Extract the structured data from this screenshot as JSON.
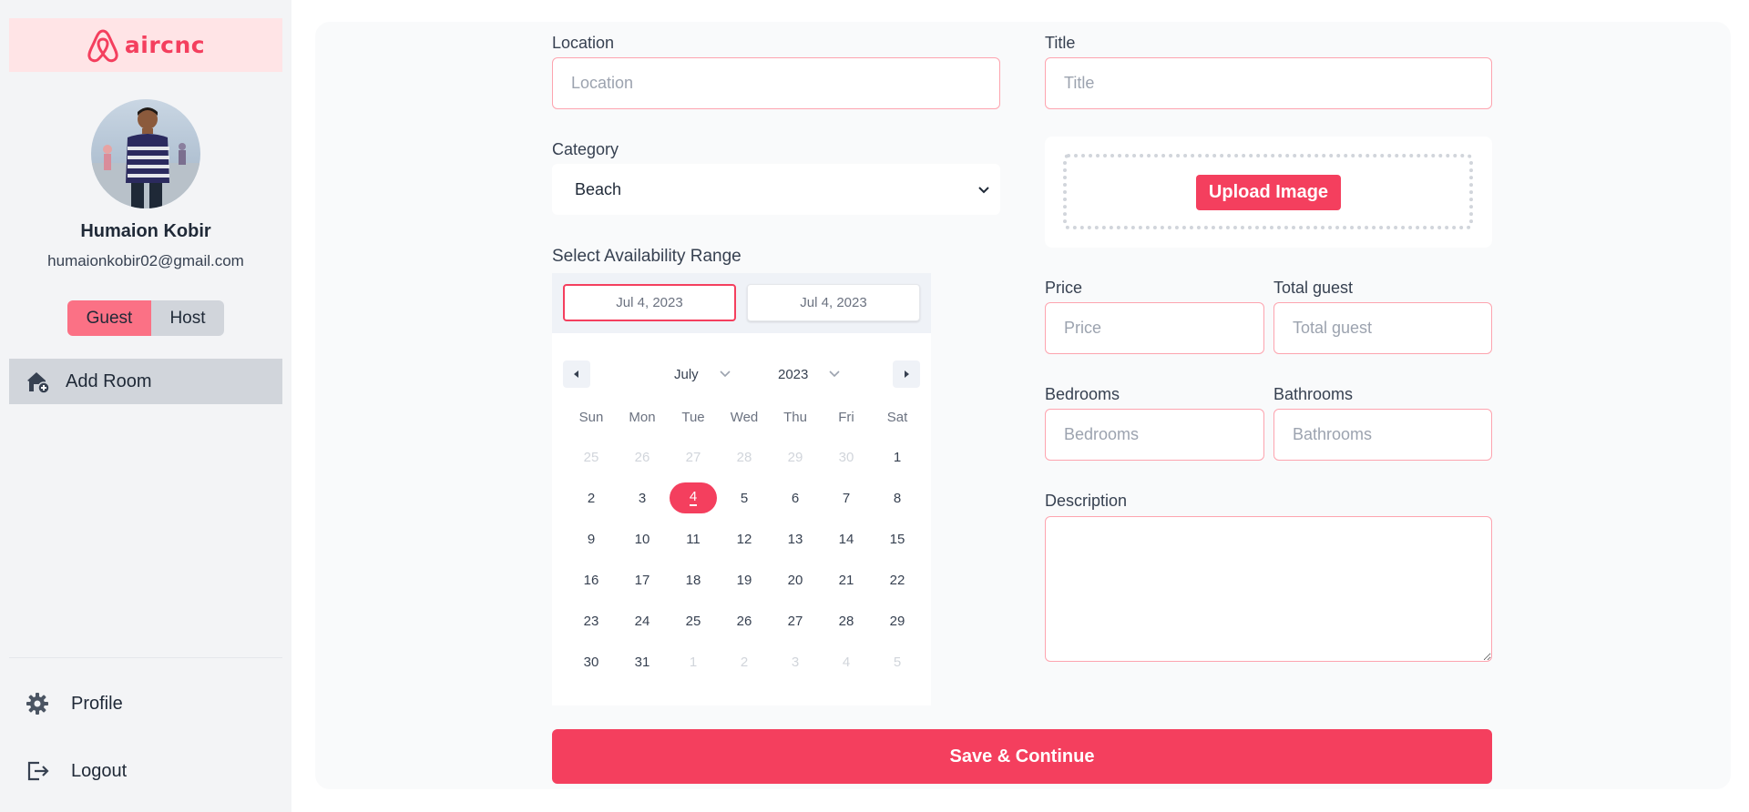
{
  "brand": {
    "name": "aircnc",
    "color": "#f43f5e"
  },
  "user": {
    "name": "Humaion Kobir",
    "email": "humaionkobir02@gmail.com"
  },
  "role_toggle": {
    "guest_label": "Guest",
    "host_label": "Host",
    "active": "Guest"
  },
  "sidebar": {
    "nav": [
      {
        "label": "Add Room",
        "icon": "house-plus-icon",
        "active": true
      }
    ],
    "bottom": [
      {
        "label": "Profile",
        "icon": "gear-icon"
      },
      {
        "label": "Logout",
        "icon": "logout-icon"
      }
    ]
  },
  "form": {
    "location": {
      "label": "Location",
      "placeholder": "Location"
    },
    "title": {
      "label": "Title",
      "placeholder": "Title"
    },
    "category": {
      "label": "Category",
      "value": "Beach"
    },
    "upload": {
      "label": "Upload Image"
    },
    "availability": {
      "label": "Select Availability Range",
      "start": "Jul 4, 2023",
      "end": "Jul 4, 2023",
      "month": "July",
      "year": "2023",
      "weekdays": [
        "Sun",
        "Mon",
        "Tue",
        "Wed",
        "Thu",
        "Fri",
        "Sat"
      ],
      "weeks": [
        [
          "25",
          "26",
          "27",
          "28",
          "29",
          "30",
          "1"
        ],
        [
          "2",
          "3",
          "4",
          "5",
          "6",
          "7",
          "8"
        ],
        [
          "9",
          "10",
          "11",
          "12",
          "13",
          "14",
          "15"
        ],
        [
          "16",
          "17",
          "18",
          "19",
          "20",
          "21",
          "22"
        ],
        [
          "23",
          "24",
          "25",
          "26",
          "27",
          "28",
          "29"
        ],
        [
          "30",
          "31",
          "1",
          "2",
          "3",
          "4",
          "5"
        ]
      ],
      "selected_day": "4"
    },
    "price": {
      "label": "Price",
      "placeholder": "Price"
    },
    "total_guest": {
      "label": "Total guest",
      "placeholder": "Total guest"
    },
    "bedrooms": {
      "label": "Bedrooms",
      "placeholder": "Bedrooms"
    },
    "bathrooms": {
      "label": "Bathrooms",
      "placeholder": "Bathrooms"
    },
    "description": {
      "label": "Description"
    },
    "submit": {
      "label": "Save & Continue"
    }
  }
}
